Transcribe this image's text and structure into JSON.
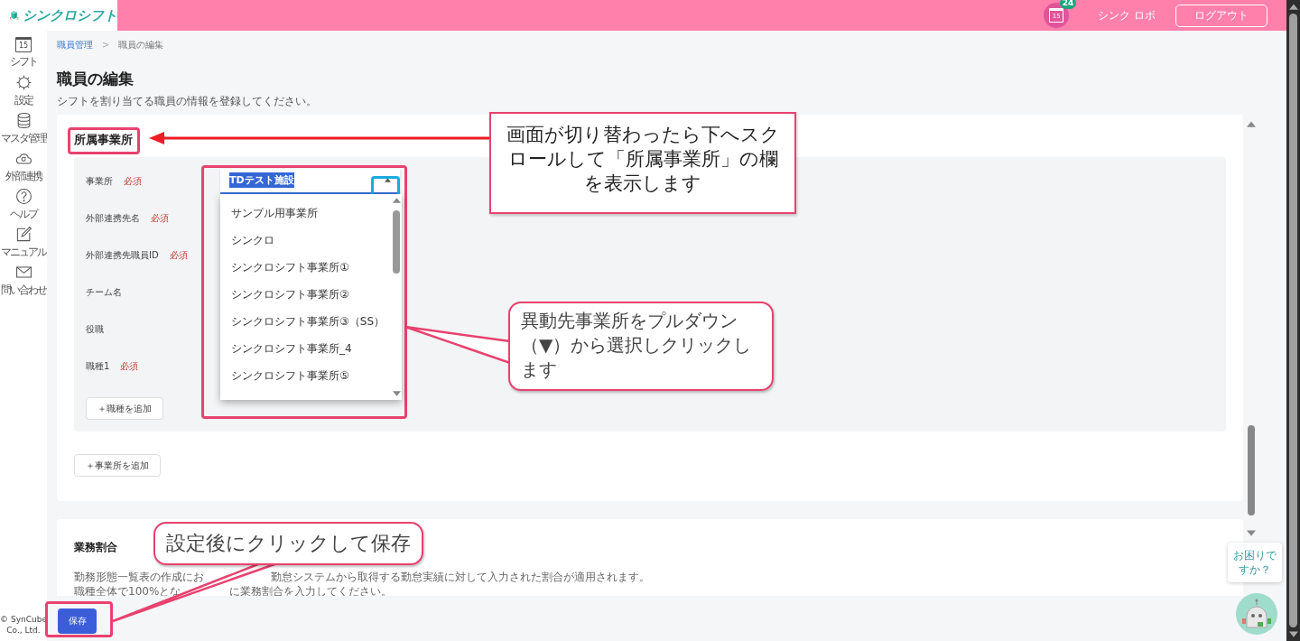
{
  "header": {
    "logo": "シンクロシフト",
    "calendar_day": "15",
    "notification_count": "24",
    "user_name": "シンク ロボ",
    "logout_button": "ログアウト"
  },
  "sidebar": {
    "items": [
      {
        "kind": "calendar",
        "label": "シフト",
        "day": "15"
      },
      {
        "kind": "gear",
        "label": "設定"
      },
      {
        "kind": "database",
        "label": "マスタ管理"
      },
      {
        "kind": "cloud",
        "label": "外部連携"
      },
      {
        "kind": "help",
        "label": "ヘルプ"
      },
      {
        "kind": "note",
        "label": "マニュアル"
      },
      {
        "kind": "mail",
        "label": "問い合わせ"
      }
    ],
    "copyright": "© SynCube Co., Ltd."
  },
  "breadcrumb": {
    "separator": ">",
    "items": [
      {
        "label": "職員管理",
        "current": false
      },
      {
        "label": "職員の編集",
        "current": true
      }
    ]
  },
  "page": {
    "title": "職員の編集",
    "description": "シフトを割り当てる職員の情報を登録してください。"
  },
  "affiliation": {
    "title": "所属事業所",
    "fields": [
      {
        "label": "事業所",
        "required": "必須"
      },
      {
        "label": "外部連携先名",
        "required": "必須"
      },
      {
        "label": "外部連携先職員ID",
        "required": "必須"
      },
      {
        "label": "チーム名"
      },
      {
        "label": "役職"
      },
      {
        "label": "職種1",
        "required": "必須"
      }
    ],
    "office_select": {
      "value": "TDテスト施設",
      "expanded": true,
      "options": [
        {
          "label": "サンプル用事業所",
          "selected": false
        },
        {
          "label": "シンクロ",
          "selected": false
        },
        {
          "label": "シンクロシフト事業所①",
          "selected": false
        },
        {
          "label": "シンクロシフト事業所②",
          "selected": false
        },
        {
          "label": "シンクロシフト事業所③（SS）",
          "selected": false
        },
        {
          "label": "シンクロシフト事業所_4",
          "selected": false
        },
        {
          "label": "シンクロシフト事業所⑤",
          "selected": false
        }
      ]
    },
    "add_job_button": "＋職種を追加",
    "add_office_button": "＋事業所を追加"
  },
  "ratio": {
    "title": "業務割合",
    "description_lines": [
      [
        "勤務形態一覧表の作成にお",
        "勤怠システムから取得する勤怠実績に対して入力された割合が適用されます。"
      ],
      [
        "職種全体で100%とな",
        "に業務割合を入力してください。"
      ]
    ]
  },
  "save_button": "保存",
  "help_widget": {
    "text": "お困りですか？"
  },
  "annotations": [
    {
      "kind": "note",
      "text": "画面が切り替わったら下へスクロールして「所属事業所」の欄を表示します"
    },
    {
      "kind": "speech",
      "text": "異動先事業所をプルダウン（▼）から選択しクリックします"
    },
    {
      "kind": "speech",
      "text": "設定後にクリックして保存"
    }
  ]
}
